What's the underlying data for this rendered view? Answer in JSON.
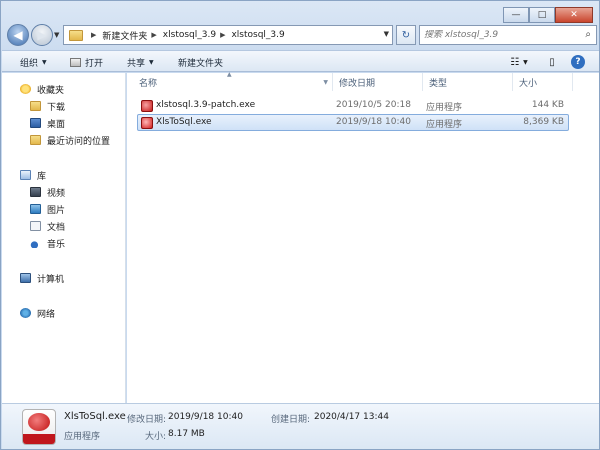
{
  "address": {
    "breadcrumbs": [
      "新建文件夹",
      "xlstosql_3.9",
      "xlstosql_3.9"
    ]
  },
  "search": {
    "placeholder": "搜索 xlstosql_3.9"
  },
  "toolbar": {
    "organize": "组织",
    "open": "打开",
    "share": "共享",
    "new_folder": "新建文件夹"
  },
  "sidebar": {
    "favorites": {
      "label": "收藏夹",
      "items": [
        "下载",
        "桌面",
        "最近访问的位置"
      ]
    },
    "libraries": {
      "label": "库",
      "items": [
        "视频",
        "图片",
        "文档",
        "音乐"
      ]
    },
    "computer": "计算机",
    "network": "网络"
  },
  "columns": [
    "名称",
    "修改日期",
    "类型",
    "大小"
  ],
  "files": [
    {
      "name": "xlstosql.3.9-patch.exe",
      "modified": "2019/10/5 20:18",
      "type": "应用程序",
      "size": "144 KB",
      "selected": false
    },
    {
      "name": "XlsToSql.exe",
      "modified": "2019/9/18 10:40",
      "type": "应用程序",
      "size": "8,369 KB",
      "selected": true
    }
  ],
  "details": {
    "name": "XlsToSql.exe",
    "type": "应用程序",
    "modified_label": "修改日期:",
    "modified": "2019/9/18 10:40",
    "created_label": "创建日期:",
    "created": "2020/4/17 13:44",
    "size_label": "大小:",
    "size": "8.17 MB"
  },
  "icons": {
    "back": "back-arrow-icon",
    "forward": "forward-arrow-icon",
    "refresh": "refresh-icon",
    "search": "search-icon",
    "view": "view-options-icon",
    "preview_pane": "preview-pane-icon",
    "help": "help-icon"
  }
}
